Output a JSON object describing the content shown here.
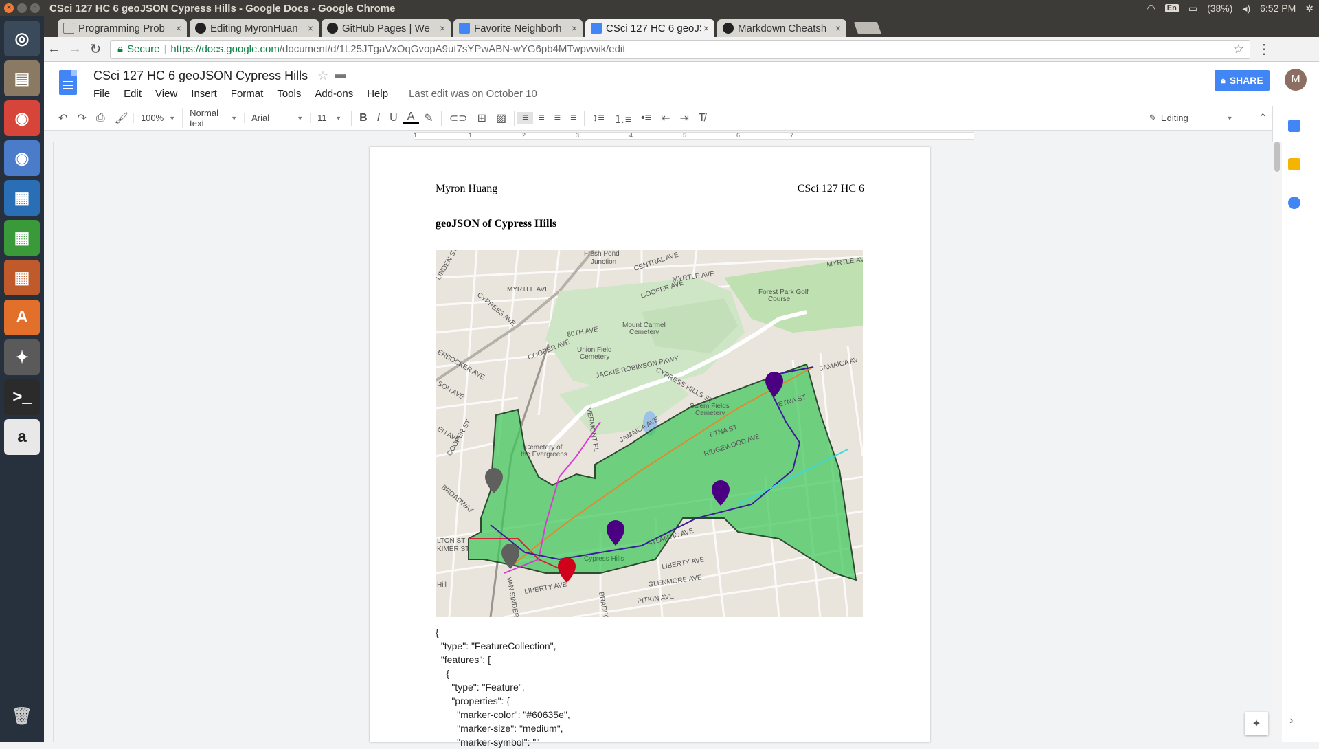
{
  "os": {
    "window_title": "CSci 127 HC 6 geoJSON Cypress Hills - Google Docs - Google Chrome",
    "tray": {
      "keyboard": "En",
      "battery": "(38%)",
      "time": "6:52 PM"
    },
    "launcher": [
      {
        "name": "ubuntu-dash-icon",
        "glyph": "◎",
        "color": "#3a4a5a"
      },
      {
        "name": "files-icon",
        "glyph": "▤",
        "color": "#8a7a64"
      },
      {
        "name": "chrome-icon",
        "glyph": "◉",
        "color": "#d7453a"
      },
      {
        "name": "chromium-icon",
        "glyph": "◉",
        "color": "#4a7cc9"
      },
      {
        "name": "writer-icon",
        "glyph": "▦",
        "color": "#2a6fb6"
      },
      {
        "name": "calc-icon",
        "glyph": "▦",
        "color": "#3a9a3a"
      },
      {
        "name": "impress-icon",
        "glyph": "▦",
        "color": "#c05a2a"
      },
      {
        "name": "software-center-icon",
        "glyph": "A",
        "color": "#e2702a"
      },
      {
        "name": "settings-icon",
        "glyph": "✦",
        "color": "#5a5a5a"
      },
      {
        "name": "terminal-icon",
        "glyph": ">_",
        "color": "#2b2b2b"
      },
      {
        "name": "amazon-icon",
        "glyph": "a",
        "color": "#e8e8e8"
      }
    ],
    "trash_icon": "trash-icon"
  },
  "browser": {
    "tabs": [
      {
        "label": "Programming Prob",
        "icon": "page-icon",
        "active": false
      },
      {
        "label": "Editing MyronHuan",
        "icon": "github-icon",
        "active": false
      },
      {
        "label": "GitHub Pages | We",
        "icon": "github-icon",
        "active": false
      },
      {
        "label": "Favorite Neighborh",
        "icon": "docs-icon",
        "active": false
      },
      {
        "label": "CSci 127 HC 6 geoJS",
        "icon": "docs-icon",
        "active": true
      },
      {
        "label": "Markdown Cheatsh",
        "icon": "github-icon",
        "active": false
      }
    ],
    "secure_label": "Secure",
    "url_scheme_host": "https://docs.google.com",
    "url_path": "/document/d/1L25JTgaVxOqGvopA9ut7sYPwABN-wYG6pb4MTwpvwik/edit"
  },
  "docs": {
    "title": "CSci 127 HC 6 geoJSON Cypress Hills",
    "menus": [
      "File",
      "Edit",
      "View",
      "Insert",
      "Format",
      "Tools",
      "Add-ons",
      "Help"
    ],
    "last_edit": "Last edit was on October 10",
    "share_label": "SHARE",
    "avatar_initial": "M",
    "toolbar": {
      "zoom": "100%",
      "style": "Normal text",
      "font": "Arial",
      "size": "11",
      "mode": "Editing"
    },
    "ruler_numbers": [
      "1",
      "1",
      "2",
      "3",
      "4",
      "5",
      "6",
      "7"
    ]
  },
  "page": {
    "header_left": "Myron Huang",
    "header_right": "CSci 127 HC 6",
    "heading": "geoJSON of Cypress Hills",
    "map_labels": {
      "fresh_pond": "Fresh Pond",
      "junction": "Junction",
      "central_ave": "CENTRAL AVE",
      "myrtle_ave_1": "MYRTLE AVE",
      "myrtle_ave_2": "MYRTLE AVE",
      "myrtle_ave_3": "MYRTLE AV",
      "cooper_ave_1": "COOPER AVE",
      "cooper_ave_2": "COOPER AVE",
      "cooper_st": "COOPER ST",
      "forest_park": "Forest Park Golf",
      "forest_park_2": "Course",
      "mount_carmel": "Mount Carmel",
      "cemetery": "Cemetery",
      "union_field": "Union Field",
      "union_cemetery": "Cemetery",
      "eightieth": "80TH AVE",
      "cypress_ave": "CYPRESS AVE",
      "jackie": "JACKIE ROBINSON PKWY",
      "cypress_hills_st": "CYPRESS HILLS ST",
      "jamaica_1": "JAMAICA AV",
      "jamaica_2": "JAMAICA AVE",
      "vermont": "VERMONT PL",
      "salem": "Salem Fields",
      "salem_2": "Cemetery",
      "etna_1": "ETNA ST",
      "etna_2": "ETNA ST",
      "ridgewood": "RIDGEWOOD AVE",
      "evergreens": "Cemetery of",
      "evergreens_2": "the Evergreens",
      "broadway": "BROADWAY",
      "fulton": "LTON ST",
      "kimer": "KIMER ST",
      "hill": "Hill",
      "cypress_hills": "Cypress Hills",
      "atlantic": "ATLANTIC AVE",
      "liberty_1": "LIBERTY AVE",
      "liberty_2": "LIBERTY AVE",
      "glenmore": "GLENMORE AVE",
      "pitkin": "PITKIN AVE",
      "van_sinder": "VAN SINDER",
      "bradford": "BRADFO",
      "linden": "LINDEN ST",
      "knickerbocker": "ERBOCKER AVE",
      "wilson": "SON AVE",
      "en_ave": "EN AVE"
    },
    "code_lines": [
      "{",
      "  \"type\": \"FeatureCollection\",",
      "  \"features\": [",
      "    {",
      "      \"type\": \"Feature\",",
      "      \"properties\": {",
      "        \"marker-color\": \"#60635e\",",
      "        \"marker-size\": \"medium\",",
      "        \"marker-symbol\": \"\""
    ]
  },
  "colors": {
    "marker_purple": "#4b0082",
    "marker_gray": "#5f605e",
    "marker_red": "#d0021b",
    "polygon_green": "#3ec85a",
    "share_blue": "#4285f4"
  }
}
